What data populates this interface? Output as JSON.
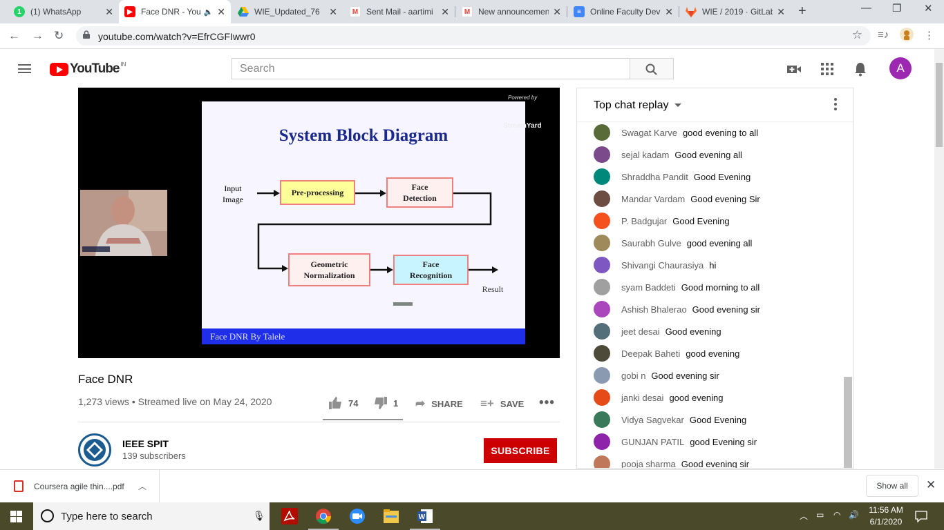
{
  "browser": {
    "tabs": [
      {
        "title": "(1) WhatsApp",
        "icon": "whatsapp-icon",
        "color": "#25d366"
      },
      {
        "title": "Face DNR - YouTube",
        "icon": "youtube-icon",
        "color": "#ff0000",
        "active": true
      },
      {
        "title": "WIE_Updated_76",
        "icon": "google-drive-icon",
        "color": "#fbbc04"
      },
      {
        "title": "Sent Mail - aartimi",
        "icon": "gmail-icon",
        "color": "#ea4335"
      },
      {
        "title": "New announcement",
        "icon": "gmail-icon",
        "color": "#ea4335"
      },
      {
        "title": "Online Faculty Dev",
        "icon": "google-forms-icon",
        "color": "#4285f4"
      },
      {
        "title": "WIE / 2019 · GitLab",
        "icon": "gitlab-icon",
        "color": "#fc6d26"
      }
    ],
    "url": "youtube.com/watch?v=EfrCGFIwwr0"
  },
  "youtube": {
    "logo_text": "YouTube",
    "country_code": "IN",
    "search_placeholder": "Search",
    "avatar_letter": "A"
  },
  "slide": {
    "title": "System Block Diagram",
    "input_label": "Input\nImage",
    "blocks": [
      "Pre-processing",
      "Face\nDetection",
      "Geometric\nNormalization",
      "Face\nRecognition"
    ],
    "result_label": "Result",
    "footer": "Face DNR  By  Talele",
    "brand_top": "Powered by",
    "brand_name": "StreamYard"
  },
  "video": {
    "title": "Face DNR",
    "meta": "1,273 views • Streamed live on May 24, 2020",
    "likes": "74",
    "dislikes": "1",
    "share_label": "SHARE",
    "save_label": "SAVE"
  },
  "channel": {
    "name": "IEEE SPIT",
    "subscribers": "139 subscribers",
    "subscribe_label": "SUBSCRIBE",
    "logo_text": "S.P.I.T."
  },
  "chat": {
    "header": "Top chat replay",
    "messages": [
      {
        "author": "Swagat Karve",
        "text": "good evening to all",
        "color": "#5a6b3a"
      },
      {
        "author": "sejal kadam",
        "text": "Good evening all",
        "color": "#7a4a8a"
      },
      {
        "author": "Shraddha Pandit",
        "text": "Good Evening",
        "color": "#00897b"
      },
      {
        "author": "Mandar Vardam",
        "text": "Good evening Sir",
        "color": "#6d4c41"
      },
      {
        "author": "P. Badgujar",
        "text": "Good Evening",
        "color": "#f4511e"
      },
      {
        "author": "Saurabh Gulve",
        "text": "good evening all",
        "color": "#9e8a5a"
      },
      {
        "author": "Shivangi Chaurasiya",
        "text": "hi",
        "color": "#7e57c2"
      },
      {
        "author": "syam Baddeti",
        "text": "Good morning to all",
        "color": "#a0a0a0"
      },
      {
        "author": "Ashish Bhalerao",
        "text": "Good evening sir",
        "color": "#ab47bc"
      },
      {
        "author": "jeet desai",
        "text": "Good evening",
        "color": "#546e7a"
      },
      {
        "author": "Deepak Baheti",
        "text": "good evening",
        "color": "#4e4a3a"
      },
      {
        "author": "gobi n",
        "text": "Good evening sir",
        "color": "#8a9ab0"
      },
      {
        "author": "janki desai",
        "text": "good evening",
        "color": "#e64a19"
      },
      {
        "author": "Vidya Sagvekar",
        "text": "Good Evening",
        "color": "#3a7a5a"
      },
      {
        "author": "GUNJAN PATIL",
        "text": "good Evening sir",
        "color": "#8e24aa"
      },
      {
        "author": "pooja sharma",
        "text": "Good evening sir",
        "color": "#c0785a"
      }
    ]
  },
  "downloads": {
    "file": "Coursera agile thin....pdf",
    "show_all": "Show all"
  },
  "taskbar": {
    "search_text": "Type here to search",
    "time": "11:56 AM",
    "date": "6/1/2020"
  }
}
